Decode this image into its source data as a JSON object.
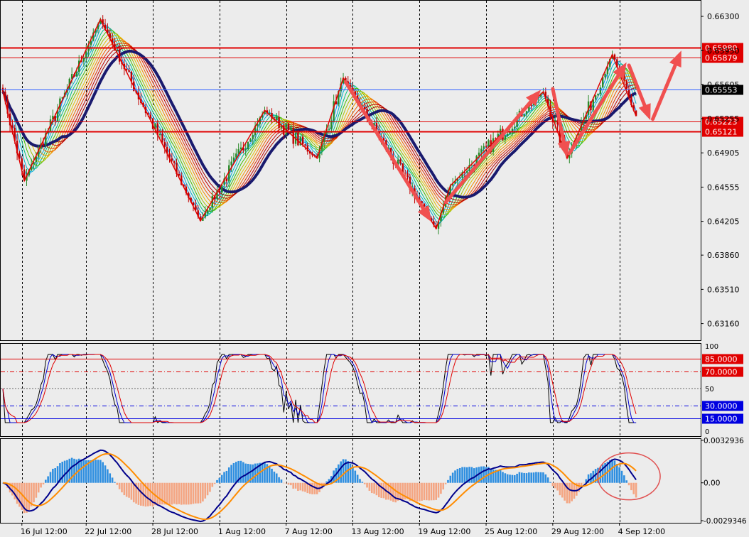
{
  "chart_data": [
    {
      "type": "candlestick",
      "panel": "price",
      "price_axis": {
        "ylim": [
          0.6299,
          0.6646
        ],
        "tick_labels": [
          "0.66300",
          "0.65950",
          "0.65605",
          "0.65255",
          "0.64905",
          "0.64555",
          "0.64205",
          "0.63860",
          "0.63510",
          "0.63160"
        ],
        "tick_values": [
          0.663,
          0.6595,
          0.65605,
          0.65255,
          0.64905,
          0.64555,
          0.64205,
          0.6386,
          0.6351,
          0.6316
        ]
      },
      "current_price": {
        "label": "0.65553",
        "value": 0.65553
      },
      "horizontal_levels": [
        {
          "label": "0.65980",
          "value": 0.6598,
          "color": "#e00000",
          "width": 2
        },
        {
          "label": "0.65879",
          "value": 0.65879,
          "color": "#e00000",
          "width": 1
        },
        {
          "label": "0.65223",
          "value": 0.65223,
          "color": "#e00000",
          "width": 1
        },
        {
          "label": "0.65121",
          "value": 0.65121,
          "color": "#e00000",
          "width": 2
        }
      ],
      "time_axis": {
        "tick_labels": [
          "16 Jul 12:00",
          "22 Jul 12:00",
          "28 Jul 12:00",
          "1 Aug 12:00",
          "7 Aug 12:00",
          "13 Aug 12:00",
          "19 Aug 12:00",
          "25 Aug 12:00",
          "29 Aug 12:00",
          "4 Sep 12:00"
        ],
        "tick_bar_index": [
          8,
          35,
          63,
          91,
          119,
          147,
          175,
          203,
          231,
          259
        ]
      },
      "zigzag_points": [
        {
          "bar": 0,
          "value": 0.6553
        },
        {
          "bar": 9,
          "value": 0.6462
        },
        {
          "bar": 41,
          "value": 0.6627
        },
        {
          "bar": 83,
          "value": 0.6421
        },
        {
          "bar": 110,
          "value": 0.6534
        },
        {
          "bar": 132,
          "value": 0.6485
        },
        {
          "bar": 143,
          "value": 0.6567
        },
        {
          "bar": 182,
          "value": 0.6413
        },
        {
          "bar": 188,
          "value": 0.6457
        },
        {
          "bar": 227,
          "value": 0.6553
        },
        {
          "bar": 237,
          "value": 0.6485
        },
        {
          "bar": 256,
          "value": 0.6591
        },
        {
          "bar": 266,
          "value": 0.6528
        }
      ],
      "trend_arrows": [
        {
          "from_bar": 144,
          "from": 0.6563,
          "to_bar": 180,
          "to": 0.642
        },
        {
          "from_bar": 186,
          "from": 0.644,
          "to_bar": 226,
          "to": 0.6555
        },
        {
          "from_bar": 231,
          "from": 0.6556,
          "to_bar": 237,
          "to": 0.6486
        },
        {
          "from_bar": 238,
          "from": 0.649,
          "to_bar": 262,
          "to": 0.6583
        },
        {
          "from_bar": 263,
          "from": 0.658,
          "to_bar": 272,
          "to": 0.6524
        },
        {
          "from_bar": 273,
          "from": 0.6525,
          "to_bar": 285,
          "to": 0.6595
        }
      ],
      "colors": {
        "bull": "#2a8a2a",
        "bear": "#c00000",
        "slow_ma": "#1a1a6e"
      }
    },
    {
      "type": "line",
      "panel": "oscillator",
      "ylim": [
        0,
        100
      ],
      "tick_labels": [
        "100",
        "50",
        "0"
      ],
      "tick_values": [
        100,
        50,
        0
      ],
      "levels": [
        {
          "label": "85.0000",
          "value": 85,
          "color": "#e00000"
        },
        {
          "label": "70.0000",
          "value": 70,
          "color": "#e00000"
        },
        {
          "label": "30.0000",
          "value": 30,
          "color": "#0000e0"
        },
        {
          "label": "15.0000",
          "value": 15,
          "color": "#0000e0"
        }
      ]
    },
    {
      "type": "bar",
      "panel": "macd",
      "ylim": [
        -0.0031,
        0.0034
      ],
      "tick_labels": [
        "0.0032936",
        "0.00",
        "-0.0029346"
      ],
      "tick_values": [
        0.0032936,
        0,
        -0.0029346
      ],
      "colors": {
        "positive": "#2f8fe0",
        "negative": "#f4a582",
        "line_fast": "#00008b",
        "line_slow": "#ff8c00"
      }
    }
  ]
}
